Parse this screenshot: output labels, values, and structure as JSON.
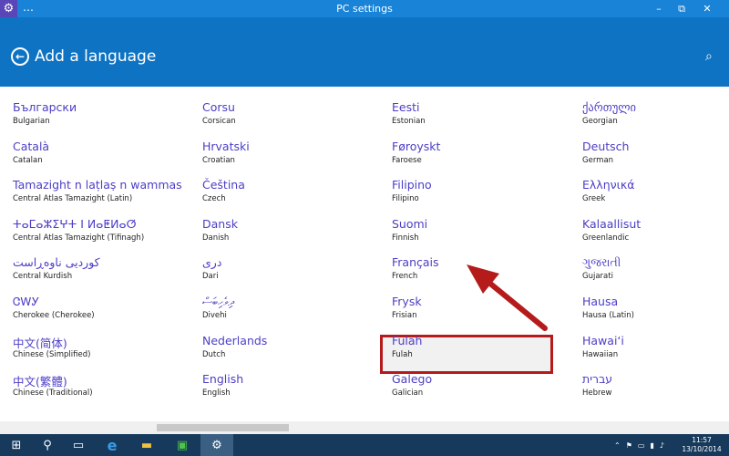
{
  "window": {
    "title": "PC settings",
    "menu_glyph": "…",
    "minimize": "–",
    "restore": "⧉",
    "close": "✕"
  },
  "header": {
    "title": "Add a language",
    "back_glyph": "←",
    "search_glyph": "⌕"
  },
  "languages": [
    {
      "native": "Български",
      "english": "Bulgarian"
    },
    {
      "native": "Català",
      "english": "Catalan"
    },
    {
      "native": "Tamazight n laṭlaṣ n wammas",
      "english": "Central Atlas Tamazight (Latin)"
    },
    {
      "native": "ⵜⴰⵎⴰⵣⵉⵖⵜ ⵏ ⵍⴰⵟⵍⴰⵚ",
      "english": "Central Atlas Tamazight (Tifinagh)"
    },
    {
      "native": "کوردیی ناوەڕاست",
      "english": "Central Kurdish"
    },
    {
      "native": "ᏣᎳᎩ",
      "english": "Cherokee (Cherokee)"
    },
    {
      "native": "中文(简体)",
      "english": "Chinese (Simplified)"
    },
    {
      "native": "中文(繁體)",
      "english": "Chinese (Traditional)"
    },
    {
      "native": "Corsu",
      "english": "Corsican"
    },
    {
      "native": "Hrvatski",
      "english": "Croatian"
    },
    {
      "native": "Čeština",
      "english": "Czech"
    },
    {
      "native": "Dansk",
      "english": "Danish"
    },
    {
      "native": "دری",
      "english": "Dari"
    },
    {
      "native": "ދިވެހިބަސް",
      "english": "Divehi"
    },
    {
      "native": "Nederlands",
      "english": "Dutch"
    },
    {
      "native": "English",
      "english": "English"
    },
    {
      "native": "Eesti",
      "english": "Estonian"
    },
    {
      "native": "Føroyskt",
      "english": "Faroese"
    },
    {
      "native": "Filipino",
      "english": "Filipino"
    },
    {
      "native": "Suomi",
      "english": "Finnish"
    },
    {
      "native": "Français",
      "english": "French"
    },
    {
      "native": "Frysk",
      "english": "Frisian"
    },
    {
      "native": "Fulah",
      "english": "Fulah"
    },
    {
      "native": "Galego",
      "english": "Galician"
    },
    {
      "native": "ქართული",
      "english": "Georgian"
    },
    {
      "native": "Deutsch",
      "english": "German"
    },
    {
      "native": "Ελληνικά",
      "english": "Greek"
    },
    {
      "native": "Kalaallisut",
      "english": "Greenlandic"
    },
    {
      "native": "ગુજરાતી",
      "english": "Gujarati"
    },
    {
      "native": "Hausa",
      "english": "Hausa (Latin)"
    },
    {
      "native": "Hawaiʻi",
      "english": "Hawaiian"
    },
    {
      "native": "עברית",
      "english": "Hebrew"
    }
  ],
  "highlighted_language": "Français",
  "colors": {
    "titlebar": "#1883d7",
    "header": "#0f73c3",
    "link": "#4b3ec6",
    "annotation": "#b51b1b",
    "taskbar": "#173a5c"
  },
  "taskbar": {
    "start_glyph": "⊞",
    "search_glyph": "⚲",
    "taskview_glyph": "▭",
    "ie_glyph": "e",
    "explorer_glyph": "▬",
    "store_glyph": "▣",
    "settings_glyph": "⚙",
    "tray_chevron": "⌃",
    "tray_flag": "⚑",
    "tray_battery": "▭",
    "tray_network": "▮",
    "tray_volume": "♪",
    "time": "11:57",
    "date": "13/10/2014"
  }
}
